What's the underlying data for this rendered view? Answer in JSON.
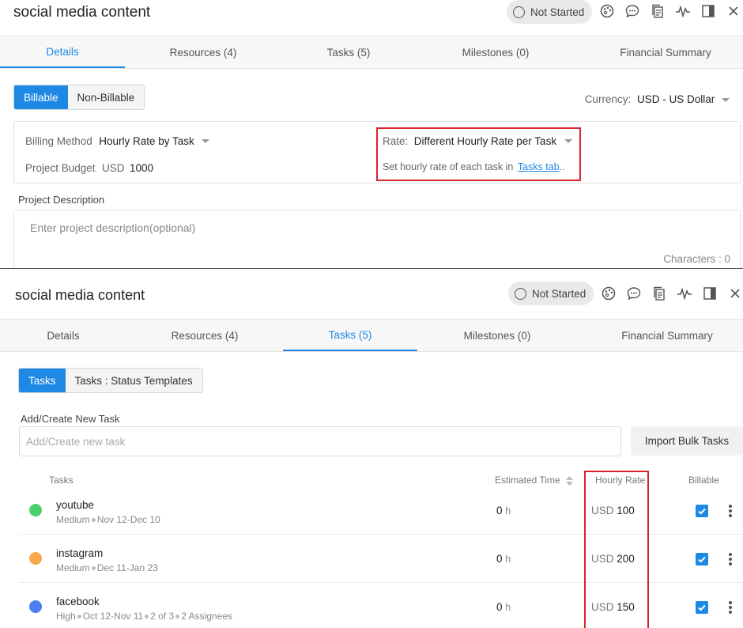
{
  "project": {
    "title": "social media content",
    "status": "Not Started"
  },
  "header_icons": [
    "palette-icon",
    "comment-icon",
    "documents-icon",
    "activity-icon",
    "split-view-icon",
    "close-icon"
  ],
  "tabs": [
    "Details",
    "Resources (4)",
    "Tasks (5)",
    "Milestones (0)",
    "Financial Summary"
  ],
  "details": {
    "billing_toggle": [
      "Billable",
      "Non-Billable"
    ],
    "currency_label": "Currency:",
    "currency_value": "USD - US Dollar",
    "billing_method_label": "Billing Method",
    "billing_method_value": "Hourly Rate by Task",
    "budget_label": "Project Budget",
    "budget_currency": "USD",
    "budget_value": "1000",
    "rate_label": "Rate:",
    "rate_value": "Different Hourly Rate per Task",
    "rate_hint": "Set hourly rate of each task in",
    "rate_hint_link": "Tasks tab",
    "rate_hint_end": "..",
    "description_label": "Project Description",
    "description_placeholder": "Enter project description(optional)",
    "characters": "Characters : 0"
  },
  "tasks_view": {
    "toggle": [
      "Tasks",
      "Tasks : Status Templates"
    ],
    "new_task_label": "Add/Create New Task",
    "new_task_placeholder": "Add/Create new task",
    "import_button": "Import Bulk Tasks",
    "columns": {
      "task": "Tasks",
      "estimated": "Estimated Time",
      "rate": "Hourly Rate",
      "billable": "Billable"
    },
    "rows": [
      {
        "name": "youtube",
        "color": "#4cd06b",
        "meta": [
          "Medium",
          "Nov 12-Dec 10"
        ],
        "estimate": "0",
        "estimate_unit": "h",
        "currency": "USD",
        "rate": "100",
        "billable": true
      },
      {
        "name": "instagram",
        "color": "#f8a94c",
        "meta": [
          "Medium",
          "Dec 11-Jan 23"
        ],
        "estimate": "0",
        "estimate_unit": "h",
        "currency": "USD",
        "rate": "200",
        "billable": true
      },
      {
        "name": "facebook",
        "color": "#4a7ff0",
        "meta": [
          "High",
          "Oct 12-Nov 11",
          "2 of 3",
          "2 Assignees"
        ],
        "estimate": "0",
        "estimate_unit": "h",
        "currency": "USD",
        "rate": "150",
        "billable": true
      }
    ]
  },
  "colors": {
    "accent": "#1e88e5",
    "highlight": "#d9232d"
  }
}
